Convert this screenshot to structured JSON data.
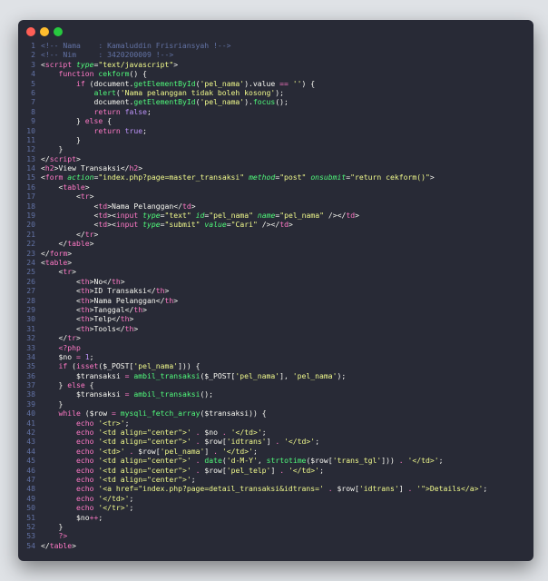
{
  "window": {
    "controls": [
      "close",
      "minimize",
      "maximize"
    ],
    "colors": {
      "close": "#ff5f56",
      "minimize": "#ffbd2e",
      "maximize": "#27c93f",
      "background": "#282a36"
    }
  },
  "lines": [
    [
      [
        "c",
        "<!-- Nama    : Kamaluddin Frisriansyah !-->"
      ]
    ],
    [
      [
        "c",
        "<!-- Nim     : 3420200009 !-->"
      ]
    ],
    [
      [
        "p",
        "<"
      ],
      [
        "t",
        "script"
      ],
      [
        "p",
        " "
      ],
      [
        "a",
        "type"
      ],
      [
        "p",
        "="
      ],
      [
        "s",
        "\"text/javascript\""
      ],
      [
        "p",
        ">"
      ]
    ],
    [
      [
        "p",
        "    "
      ],
      [
        "k",
        "function"
      ],
      [
        "p",
        " "
      ],
      [
        "f",
        "cekform"
      ],
      [
        "p",
        "() {"
      ]
    ],
    [
      [
        "p",
        "        "
      ],
      [
        "k",
        "if"
      ],
      [
        "p",
        " (document."
      ],
      [
        "f",
        "getElementById"
      ],
      [
        "p",
        "("
      ],
      [
        "s",
        "'pel_nama'"
      ],
      [
        "p",
        ").value "
      ],
      [
        "k",
        "=="
      ],
      [
        "p",
        " "
      ],
      [
        "s",
        "''"
      ],
      [
        "p",
        ") {"
      ]
    ],
    [
      [
        "p",
        "            "
      ],
      [
        "f",
        "alert"
      ],
      [
        "p",
        "("
      ],
      [
        "s",
        "'Nama pelanggan tidak boleh kosong'"
      ],
      [
        "p",
        ");"
      ]
    ],
    [
      [
        "p",
        "            document."
      ],
      [
        "f",
        "getElementById"
      ],
      [
        "p",
        "("
      ],
      [
        "s",
        "'pel_nama'"
      ],
      [
        "p",
        ")."
      ],
      [
        "f",
        "focus"
      ],
      [
        "p",
        "();"
      ]
    ],
    [
      [
        "p",
        "            "
      ],
      [
        "k",
        "return"
      ],
      [
        "p",
        " "
      ],
      [
        "n",
        "false"
      ],
      [
        "p",
        ";"
      ]
    ],
    [
      [
        "p",
        "        } "
      ],
      [
        "k",
        "else"
      ],
      [
        "p",
        " {"
      ]
    ],
    [
      [
        "p",
        "            "
      ],
      [
        "k",
        "return"
      ],
      [
        "p",
        " "
      ],
      [
        "n",
        "true"
      ],
      [
        "p",
        ";"
      ]
    ],
    [
      [
        "p",
        "        }"
      ]
    ],
    [
      [
        "p",
        "    }"
      ]
    ],
    [
      [
        "p",
        "</"
      ],
      [
        "t",
        "script"
      ],
      [
        "p",
        ">"
      ]
    ],
    [
      [
        "p",
        "<"
      ],
      [
        "t",
        "h2"
      ],
      [
        "p",
        ">View Transaksi</"
      ],
      [
        "t",
        "h2"
      ],
      [
        "p",
        ">"
      ]
    ],
    [
      [
        "p",
        "<"
      ],
      [
        "t",
        "form"
      ],
      [
        "p",
        " "
      ],
      [
        "a",
        "action"
      ],
      [
        "p",
        "="
      ],
      [
        "s",
        "\"index.php?page=master_transaksi\""
      ],
      [
        "p",
        " "
      ],
      [
        "a",
        "method"
      ],
      [
        "p",
        "="
      ],
      [
        "s",
        "\"post\""
      ],
      [
        "p",
        " "
      ],
      [
        "a",
        "onsubmit"
      ],
      [
        "p",
        "="
      ],
      [
        "s",
        "\"return cekform()\""
      ],
      [
        "p",
        ">"
      ]
    ],
    [
      [
        "p",
        "    <"
      ],
      [
        "t",
        "table"
      ],
      [
        "p",
        ">"
      ]
    ],
    [
      [
        "p",
        "        <"
      ],
      [
        "t",
        "tr"
      ],
      [
        "p",
        ">"
      ]
    ],
    [
      [
        "p",
        "            <"
      ],
      [
        "t",
        "td"
      ],
      [
        "p",
        ">Nama Pelanggan</"
      ],
      [
        "t",
        "td"
      ],
      [
        "p",
        ">"
      ]
    ],
    [
      [
        "p",
        "            <"
      ],
      [
        "t",
        "td"
      ],
      [
        "p",
        "><"
      ],
      [
        "t",
        "input"
      ],
      [
        "p",
        " "
      ],
      [
        "a",
        "type"
      ],
      [
        "p",
        "="
      ],
      [
        "s",
        "\"text\""
      ],
      [
        "p",
        " "
      ],
      [
        "a",
        "id"
      ],
      [
        "p",
        "="
      ],
      [
        "s",
        "\"pel_nama\""
      ],
      [
        "p",
        " "
      ],
      [
        "a",
        "name"
      ],
      [
        "p",
        "="
      ],
      [
        "s",
        "\"pel_nama\""
      ],
      [
        "p",
        " /></"
      ],
      [
        "t",
        "td"
      ],
      [
        "p",
        ">"
      ]
    ],
    [
      [
        "p",
        "            <"
      ],
      [
        "t",
        "td"
      ],
      [
        "p",
        "><"
      ],
      [
        "t",
        "input"
      ],
      [
        "p",
        " "
      ],
      [
        "a",
        "type"
      ],
      [
        "p",
        "="
      ],
      [
        "s",
        "\"submit\""
      ],
      [
        "p",
        " "
      ],
      [
        "a",
        "value"
      ],
      [
        "p",
        "="
      ],
      [
        "s",
        "\"Cari\""
      ],
      [
        "p",
        " /></"
      ],
      [
        "t",
        "td"
      ],
      [
        "p",
        ">"
      ]
    ],
    [
      [
        "p",
        "        </"
      ],
      [
        "t",
        "tr"
      ],
      [
        "p",
        ">"
      ]
    ],
    [
      [
        "p",
        "    </"
      ],
      [
        "t",
        "table"
      ],
      [
        "p",
        ">"
      ]
    ],
    [
      [
        "p",
        "</"
      ],
      [
        "t",
        "form"
      ],
      [
        "p",
        ">"
      ]
    ],
    [
      [
        "p",
        "<"
      ],
      [
        "t",
        "table"
      ],
      [
        "p",
        ">"
      ]
    ],
    [
      [
        "p",
        "    <"
      ],
      [
        "t",
        "tr"
      ],
      [
        "p",
        ">"
      ]
    ],
    [
      [
        "p",
        "        <"
      ],
      [
        "t",
        "th"
      ],
      [
        "p",
        ">No</"
      ],
      [
        "t",
        "th"
      ],
      [
        "p",
        ">"
      ]
    ],
    [
      [
        "p",
        "        <"
      ],
      [
        "t",
        "th"
      ],
      [
        "p",
        ">ID Transaksi</"
      ],
      [
        "t",
        "th"
      ],
      [
        "p",
        ">"
      ]
    ],
    [
      [
        "p",
        "        <"
      ],
      [
        "t",
        "th"
      ],
      [
        "p",
        ">Nama Pelanggan</"
      ],
      [
        "t",
        "th"
      ],
      [
        "p",
        ">"
      ]
    ],
    [
      [
        "p",
        "        <"
      ],
      [
        "t",
        "th"
      ],
      [
        "p",
        ">Tanggal</"
      ],
      [
        "t",
        "th"
      ],
      [
        "p",
        ">"
      ]
    ],
    [
      [
        "p",
        "        <"
      ],
      [
        "t",
        "th"
      ],
      [
        "p",
        ">Telp</"
      ],
      [
        "t",
        "th"
      ],
      [
        "p",
        ">"
      ]
    ],
    [
      [
        "p",
        "        <"
      ],
      [
        "t",
        "th"
      ],
      [
        "p",
        ">Tools</"
      ],
      [
        "t",
        "th"
      ],
      [
        "p",
        ">"
      ]
    ],
    [
      [
        "p",
        "    </"
      ],
      [
        "t",
        "tr"
      ],
      [
        "p",
        ">"
      ]
    ],
    [
      [
        "p",
        "    "
      ],
      [
        "t",
        "<?php"
      ]
    ],
    [
      [
        "p",
        "    $no "
      ],
      [
        "k",
        "="
      ],
      [
        "p",
        " "
      ],
      [
        "n",
        "1"
      ],
      [
        "p",
        ";"
      ]
    ],
    [
      [
        "p",
        "    "
      ],
      [
        "k",
        "if"
      ],
      [
        "p",
        " ("
      ],
      [
        "k",
        "isset"
      ],
      [
        "p",
        "($_POST["
      ],
      [
        "s",
        "'pel_nama'"
      ],
      [
        "p",
        "])) {"
      ]
    ],
    [
      [
        "p",
        "        $transaksi "
      ],
      [
        "k",
        "="
      ],
      [
        "p",
        " "
      ],
      [
        "f",
        "ambil_transaksi"
      ],
      [
        "p",
        "($_POST["
      ],
      [
        "s",
        "'pel_nama'"
      ],
      [
        "p",
        "], "
      ],
      [
        "s",
        "'pel_nama'"
      ],
      [
        "p",
        ");"
      ]
    ],
    [
      [
        "p",
        "    } "
      ],
      [
        "k",
        "else"
      ],
      [
        "p",
        " {"
      ]
    ],
    [
      [
        "p",
        "        $transaksi "
      ],
      [
        "k",
        "="
      ],
      [
        "p",
        " "
      ],
      [
        "f",
        "ambil_transaksi"
      ],
      [
        "p",
        "();"
      ]
    ],
    [
      [
        "p",
        "    }"
      ]
    ],
    [
      [
        "p",
        "    "
      ],
      [
        "k",
        "while"
      ],
      [
        "p",
        " ($row "
      ],
      [
        "k",
        "="
      ],
      [
        "p",
        " "
      ],
      [
        "f",
        "mysqli_fetch_array"
      ],
      [
        "p",
        "($transaksi)) {"
      ]
    ],
    [
      [
        "p",
        "        "
      ],
      [
        "k",
        "echo"
      ],
      [
        "p",
        " "
      ],
      [
        "s",
        "'<tr>'"
      ],
      [
        "p",
        ";"
      ]
    ],
    [
      [
        "p",
        "        "
      ],
      [
        "k",
        "echo"
      ],
      [
        "p",
        " "
      ],
      [
        "s",
        "'<td align=\"center\">'"
      ],
      [
        "p",
        " "
      ],
      [
        "k",
        "."
      ],
      [
        "p",
        " $no "
      ],
      [
        "k",
        "."
      ],
      [
        "p",
        " "
      ],
      [
        "s",
        "'</td>'"
      ],
      [
        "p",
        ";"
      ]
    ],
    [
      [
        "p",
        "        "
      ],
      [
        "k",
        "echo"
      ],
      [
        "p",
        " "
      ],
      [
        "s",
        "'<td align=\"center\">'"
      ],
      [
        "p",
        " "
      ],
      [
        "k",
        "."
      ],
      [
        "p",
        " $row["
      ],
      [
        "s",
        "'idtrans'"
      ],
      [
        "p",
        "] "
      ],
      [
        "k",
        "."
      ],
      [
        "p",
        " "
      ],
      [
        "s",
        "'</td>'"
      ],
      [
        "p",
        ";"
      ]
    ],
    [
      [
        "p",
        "        "
      ],
      [
        "k",
        "echo"
      ],
      [
        "p",
        " "
      ],
      [
        "s",
        "'<td>'"
      ],
      [
        "p",
        " "
      ],
      [
        "k",
        "."
      ],
      [
        "p",
        " $row["
      ],
      [
        "s",
        "'pel_nama'"
      ],
      [
        "p",
        "] "
      ],
      [
        "k",
        "."
      ],
      [
        "p",
        " "
      ],
      [
        "s",
        "'</td>'"
      ],
      [
        "p",
        ";"
      ]
    ],
    [
      [
        "p",
        "        "
      ],
      [
        "k",
        "echo"
      ],
      [
        "p",
        " "
      ],
      [
        "s",
        "'<td align=\"center\">'"
      ],
      [
        "p",
        " "
      ],
      [
        "k",
        "."
      ],
      [
        "p",
        " "
      ],
      [
        "f",
        "date"
      ],
      [
        "p",
        "("
      ],
      [
        "s",
        "'d-M-Y'"
      ],
      [
        "p",
        ", "
      ],
      [
        "f",
        "strtotime"
      ],
      [
        "p",
        "($row["
      ],
      [
        "s",
        "'trans_tgl'"
      ],
      [
        "p",
        "])) "
      ],
      [
        "k",
        "."
      ],
      [
        "p",
        " "
      ],
      [
        "s",
        "'</td>'"
      ],
      [
        "p",
        ";"
      ]
    ],
    [
      [
        "p",
        "        "
      ],
      [
        "k",
        "echo"
      ],
      [
        "p",
        " "
      ],
      [
        "s",
        "'<td align=\"center\">'"
      ],
      [
        "p",
        " "
      ],
      [
        "k",
        "."
      ],
      [
        "p",
        " $row["
      ],
      [
        "s",
        "'pel_telp'"
      ],
      [
        "p",
        "] "
      ],
      [
        "k",
        "."
      ],
      [
        "p",
        " "
      ],
      [
        "s",
        "'</td>'"
      ],
      [
        "p",
        ";"
      ]
    ],
    [
      [
        "p",
        "        "
      ],
      [
        "k",
        "echo"
      ],
      [
        "p",
        " "
      ],
      [
        "s",
        "'<td align=\"center\">'"
      ],
      [
        "p",
        ";"
      ]
    ],
    [
      [
        "p",
        "        "
      ],
      [
        "k",
        "echo"
      ],
      [
        "p",
        " "
      ],
      [
        "s",
        "'<a href=\"index.php?page=detail_transaksi&idtrans='"
      ],
      [
        "p",
        " "
      ],
      [
        "k",
        "."
      ],
      [
        "p",
        " $row["
      ],
      [
        "s",
        "'idtrans'"
      ],
      [
        "p",
        "] "
      ],
      [
        "k",
        "."
      ],
      [
        "p",
        " "
      ],
      [
        "s",
        "'\">Details</a>'"
      ],
      [
        "p",
        ";"
      ]
    ],
    [
      [
        "p",
        "        "
      ],
      [
        "k",
        "echo"
      ],
      [
        "p",
        " "
      ],
      [
        "s",
        "'</td>'"
      ],
      [
        "p",
        ";"
      ]
    ],
    [
      [
        "p",
        "        "
      ],
      [
        "k",
        "echo"
      ],
      [
        "p",
        " "
      ],
      [
        "s",
        "'</tr>'"
      ],
      [
        "p",
        ";"
      ]
    ],
    [
      [
        "p",
        "        $no"
      ],
      [
        "k",
        "++"
      ],
      [
        "p",
        ";"
      ]
    ],
    [
      [
        "p",
        "    }"
      ]
    ],
    [
      [
        "p",
        "    "
      ],
      [
        "t",
        "?>"
      ]
    ],
    [
      [
        "p",
        "</"
      ],
      [
        "t",
        "table"
      ],
      [
        "p",
        ">"
      ]
    ]
  ]
}
